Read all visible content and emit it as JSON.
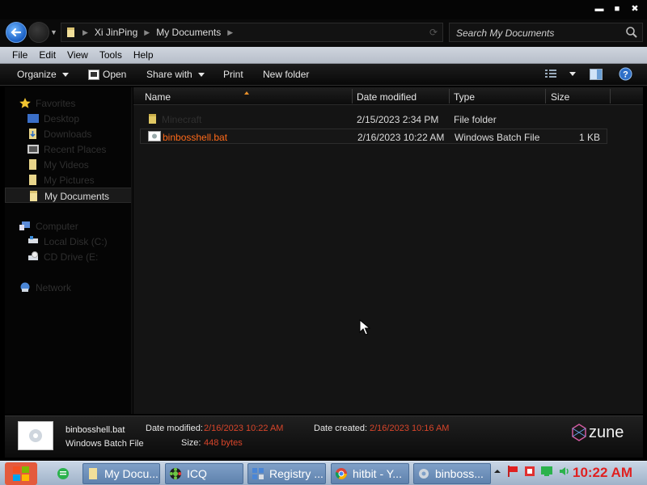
{
  "window": {
    "buttons": {
      "minimize": "▬",
      "maximize": "■",
      "close": "✖"
    }
  },
  "address": {
    "crumbs": [
      "Xi JinPing",
      "My Documents"
    ],
    "search_placeholder": "Search My Documents"
  },
  "menu": [
    "File",
    "Edit",
    "View",
    "Tools",
    "Help"
  ],
  "toolbar": {
    "organize": "Organize",
    "open": "Open",
    "share_with": "Share with",
    "print": "Print",
    "new_folder": "New folder"
  },
  "sidebar": {
    "favorites": "Favorites",
    "desktop": "Desktop",
    "downloads": "Downloads",
    "recent_places": "Recent Places",
    "my_videos": "My Videos",
    "my_pictures": "My Pictures",
    "my_documents": "My Documents",
    "computer": "Computer",
    "local_disk": "Local Disk (C:)",
    "cd_drive": "CD Drive (E:",
    "network": "Network"
  },
  "columns": {
    "name": "Name",
    "date_modified": "Date modified",
    "type": "Type",
    "size": "Size"
  },
  "files": [
    {
      "name": "Minecraft",
      "date": "2/15/2023 2:34 PM",
      "type": "File folder",
      "size": ""
    },
    {
      "name": "binbosshell.bat",
      "date": "2/16/2023 10:22 AM",
      "type": "Windows Batch File",
      "size": "1 KB"
    }
  ],
  "details": {
    "filename": "binbosshell.bat",
    "filetype": "Windows Batch File",
    "date_modified_label": "Date modified:",
    "date_modified": "2/16/2023 10:22 AM",
    "date_created_label": "Date created:",
    "date_created": "2/16/2023 10:16 AM",
    "size_label": "Size:",
    "size": "448 bytes",
    "brand": "zune"
  },
  "taskbar": {
    "buttons": [
      "My Docu...",
      "ICQ",
      "Registry ...",
      "hitbit - Y...",
      "binboss..."
    ],
    "clock": "10:22 AM"
  },
  "colors": {
    "accent_orange": "#ff6a1a",
    "date_red": "#d8452a",
    "clock_red": "#e02020"
  }
}
